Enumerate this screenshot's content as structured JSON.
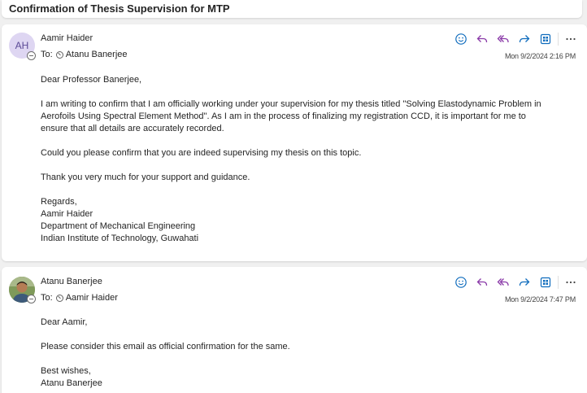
{
  "subject": "Confirmation of Thesis Supervision for MTP",
  "colors": {
    "accent": "#0f6cbd",
    "reply_purple": "#8a3aa8",
    "avatar_bg": "#ded6f2"
  },
  "messages": [
    {
      "avatar_initials": "AH",
      "sender": "Aamir Haider",
      "to_label": "To:",
      "recipient": "Atanu Banerjee",
      "timestamp": "Mon 9/2/2024 2:16 PM",
      "body": {
        "greeting": "Dear Professor Banerjee,",
        "p1_l1": "I am writing to confirm that I am officially working under your supervision for my thesis titled \"Solving Elastodynamic Problem in",
        "p1_l2": "Aerofoils Using Spectral Element Method\".  As I am in the process of finalizing my registration CCD, it is important for me to",
        "p1_l3": "ensure that all details are accurately recorded.",
        "p2": "Could you please confirm that you are indeed supervising my thesis on this topic.",
        "p3": "Thank you very much for your support and guidance.",
        "sig1": "Regards,",
        "sig2": "Aamir Haider",
        "sig3": "Department of Mechanical Engineering",
        "sig4": "Indian Institute of Technology, Guwahati"
      }
    },
    {
      "sender": "Atanu Banerjee",
      "to_label": "To:",
      "recipient": "Aamir Haider",
      "timestamp": "Mon 9/2/2024 7:47 PM",
      "body": {
        "greeting": "Dear Aamir,",
        "p1": "Please consider this email as official confirmation for the same.",
        "sig1": "Best wishes,",
        "sig2": "Atanu Banerjee"
      }
    }
  ],
  "toolbar_icons": [
    "emoji-icon",
    "reply-icon",
    "reply-all-icon",
    "forward-icon",
    "apps-icon",
    "more-icon"
  ]
}
